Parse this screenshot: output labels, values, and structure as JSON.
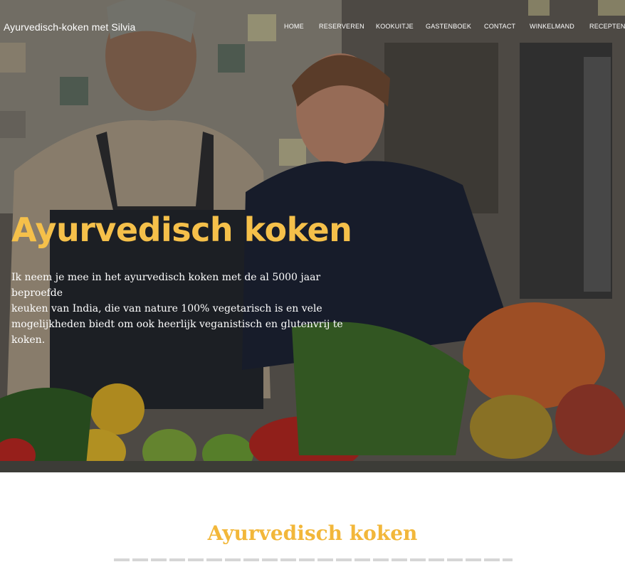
{
  "header": {
    "site_title": "Ayurvedisch-koken met Silvia",
    "nav": [
      "HOME",
      "RESERVEREN",
      "KOOKUITJE",
      "GASTENBOEK",
      "CONTACT",
      "WINKELMAND",
      "RECEPTEN"
    ]
  },
  "hero": {
    "title": "Ayurvedisch koken",
    "lines": [
      "Ik neem je mee in het ayurvedisch koken met de al 5000 jaar beproefde",
      "keuken van India, die van nature 100% vegetarisch is en vele",
      "mogelijkheden biedt om ook heerlijk veganistisch en glutenvrij te koken."
    ]
  },
  "section": {
    "title": "Ayurvedisch koken"
  },
  "colors": {
    "accent": "#f5c04a",
    "section_title": "#f2b73a"
  }
}
